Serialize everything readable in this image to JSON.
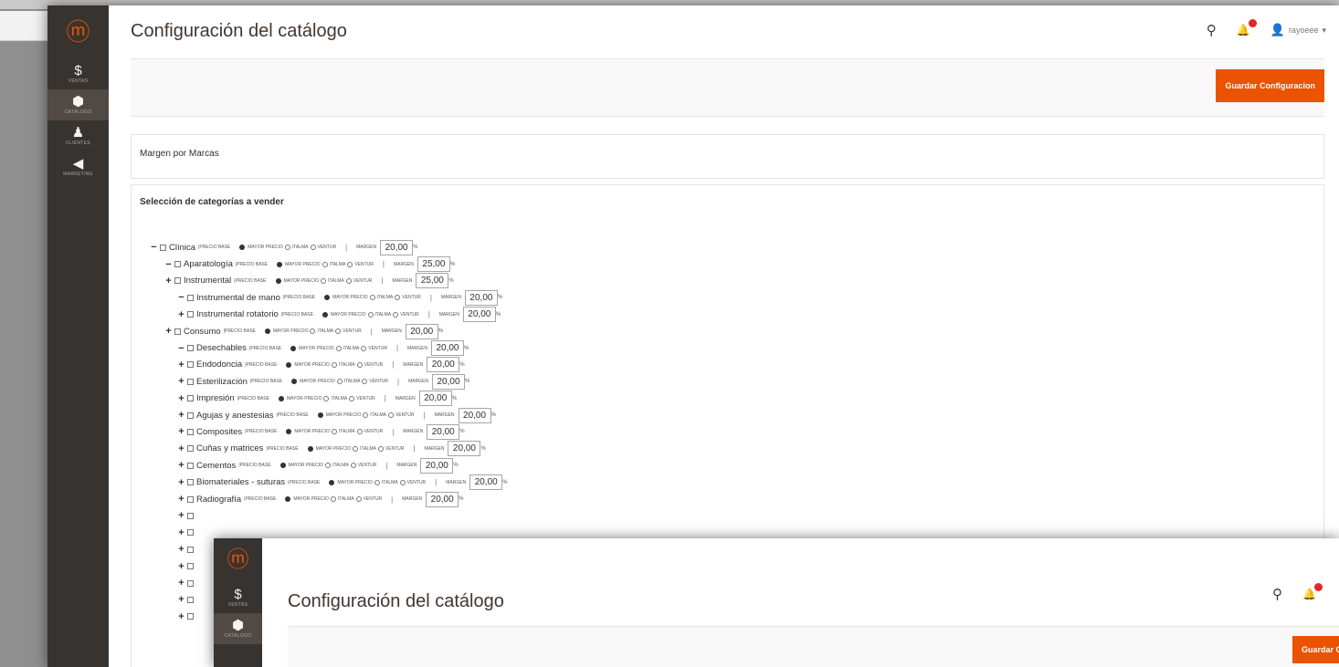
{
  "app": {
    "brand_glyph": "ⓜ",
    "accent_color": "#eb5202",
    "sidebar_color": "#373330",
    "nav": [
      {
        "label": "VENTAS",
        "icon": "$"
      },
      {
        "label": "CATÁLOGO",
        "icon": "⬢"
      },
      {
        "label": "CLIENTES",
        "icon": "♟"
      },
      {
        "label": "MARKETING",
        "icon": "◀"
      }
    ]
  },
  "header": {
    "title": "Configuración del catálogo",
    "search_icon": "⚲",
    "notif_icon": "🔔",
    "user_name": "rayoeee",
    "user_caret": "▾"
  },
  "toolbar": {
    "save_label": "Guardar Configuracion"
  },
  "sections": {
    "brands": {
      "title": "Margen por Marcas"
    },
    "categories": {
      "title": "Selección de categorías a vender"
    }
  },
  "tree_labels": {
    "base_price": "PRECIO BASE",
    "opt1": "Mayor precio",
    "opt2": "Italma",
    "opt3": "Ventur",
    "margin": "MARGEN",
    "pct": "%",
    "sep": "|",
    "collapse": "−",
    "expand": "+"
  },
  "tree": [
    {
      "name": "Clínica",
      "level": 0,
      "state": "collapse",
      "margin": "20,00"
    },
    {
      "name": "Aparatología",
      "level": 1,
      "state": "collapse",
      "margin": "25,00"
    },
    {
      "name": "Instrumental",
      "level": 1,
      "state": "expand",
      "margin": "25,00"
    },
    {
      "name": "Instrumental de mano",
      "level": 2,
      "state": "collapse",
      "margin": "20,00"
    },
    {
      "name": "Instrumental rotatorio",
      "level": 2,
      "state": "expand",
      "margin": "20,00"
    },
    {
      "name": "Consumo",
      "level": 1,
      "state": "expand",
      "margin": "20,00"
    },
    {
      "name": "Desechables",
      "level": 2,
      "state": "collapse",
      "margin": "20,00"
    },
    {
      "name": "Endodoncia",
      "level": 2,
      "state": "expand",
      "margin": "20,00"
    },
    {
      "name": "Esterilización",
      "level": 2,
      "state": "expand",
      "margin": "20,00"
    },
    {
      "name": "Impresión",
      "level": 2,
      "state": "expand",
      "margin": "20,00"
    },
    {
      "name": "Agujas y anestesias",
      "level": 2,
      "state": "expand",
      "margin": "20,00"
    },
    {
      "name": "Composites",
      "level": 2,
      "state": "expand",
      "margin": "20,00"
    },
    {
      "name": "Cuñas y matrices",
      "level": 2,
      "state": "expand",
      "margin": "20,00"
    },
    {
      "name": "Cementos",
      "level": 2,
      "state": "expand",
      "margin": "20,00"
    },
    {
      "name": "Biomateriales - suturas",
      "level": 2,
      "state": "expand",
      "margin": "20,00"
    },
    {
      "name": "Radiografía",
      "level": 2,
      "state": "expand",
      "margin": "20,00"
    },
    {
      "name": "",
      "level": 2,
      "state": "expand",
      "margin": ""
    },
    {
      "name": "",
      "level": 2,
      "state": "expand",
      "margin": ""
    },
    {
      "name": "",
      "level": 2,
      "state": "expand",
      "margin": ""
    },
    {
      "name": "",
      "level": 2,
      "state": "expand",
      "margin": ""
    },
    {
      "name": "",
      "level": 2,
      "state": "expand",
      "margin": ""
    },
    {
      "name": "",
      "level": 2,
      "state": "expand",
      "margin": ""
    },
    {
      "name": "",
      "level": 2,
      "state": "expand",
      "margin": ""
    }
  ]
}
